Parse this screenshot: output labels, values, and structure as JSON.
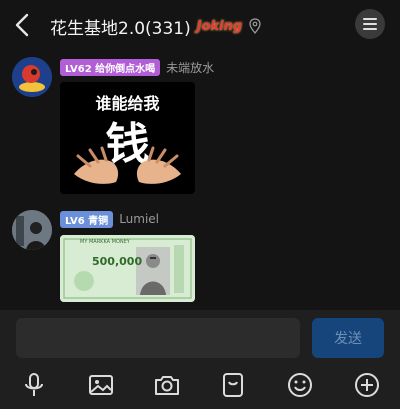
{
  "header": {
    "title": "花生基地2.0(331)",
    "badge_text": "Joking"
  },
  "messages": [
    {
      "level": "LV62 给你倒点水喝",
      "nickname": "未端放水",
      "image_text_top": "谁能给我",
      "image_text_big": "钱"
    },
    {
      "level": "LV6 青铜",
      "nickname": "Lumiel",
      "banknote_text": "MY MARKKA MONEY",
      "banknote_value": "500,000"
    }
  ],
  "input": {
    "value": "",
    "send_label": "发送"
  },
  "toolbar": {
    "icons": [
      "microphone-icon",
      "image-icon",
      "camera-icon",
      "sticker-icon",
      "emoji-icon",
      "plus-icon"
    ]
  },
  "colors": {
    "accent": "#15457a",
    "level_purple": "#b25ed6",
    "level_blue": "#6b8fd9"
  }
}
